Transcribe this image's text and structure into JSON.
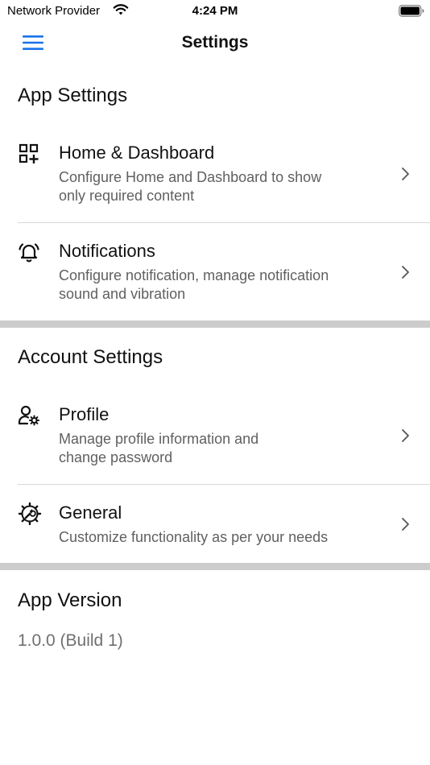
{
  "status_bar": {
    "carrier": "Network Provider",
    "time": "4:24 PM",
    "wifi_icon": "wifi-icon",
    "battery_icon": "battery-icon"
  },
  "nav": {
    "title": "Settings",
    "menu_icon": "hamburger-menu-icon",
    "accent_color": "#1a73e8"
  },
  "app_settings": {
    "title": "App Settings",
    "items": [
      {
        "label": "Home & Dashboard",
        "desc_line1": "Configure Home and Dashboard to show",
        "desc_line2": "only required content",
        "icon": "dashboard-grid-icon"
      },
      {
        "label": "Notifications",
        "desc_line1": "Configure notification, manage notification",
        "desc_line2": "sound and vibration",
        "icon": "bell-icon"
      }
    ]
  },
  "account_settings": {
    "title": "Account Settings",
    "items": [
      {
        "label": "Profile",
        "desc_line1": "Manage profile information and",
        "desc_line2": "change password",
        "icon": "user-gear-icon"
      },
      {
        "label": "General",
        "desc_line1": "Customize functionality as per your needs",
        "desc_line2": "",
        "icon": "settings-wrench-icon"
      }
    ]
  },
  "app_version": {
    "title": "App Version",
    "value": "1.0.0 (Build 1)"
  }
}
